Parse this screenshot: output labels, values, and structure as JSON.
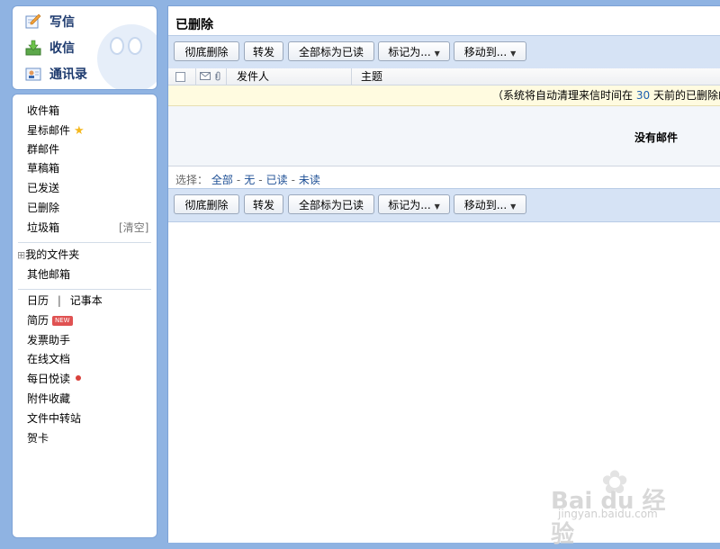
{
  "quick_actions": {
    "compose": "写信",
    "inbox": "收信",
    "contacts": "通讯录"
  },
  "nav": {
    "folders": [
      "收件箱",
      "星标邮件",
      "群邮件",
      "草稿箱",
      "已发送",
      "已删除",
      "垃圾箱"
    ],
    "trash_clear": "[清空]",
    "my_folders": "我的文件夹",
    "my_folders_toggle": "⊞",
    "other_mailboxes": "其他邮箱",
    "calendar": "日历",
    "divider": "|",
    "notebook": "记事本",
    "resume": "简历",
    "new_badge": "NEW",
    "invoice_helper": "发票助手",
    "online_docs": "在线文档",
    "daily_read": "每日悦读",
    "attachments": "附件收藏",
    "file_transfer": "文件中转站",
    "cards": "贺卡"
  },
  "main": {
    "title": "已删除",
    "toolbar": {
      "delete_permanently": "彻底删除",
      "forward": "转发",
      "mark_all_read": "全部标为已读",
      "mark_as": "标记为...",
      "move_to": "移动到..."
    },
    "columns": {
      "sender": "发件人",
      "subject": "主题"
    },
    "notice": {
      "prefix": "（系统将自动清理来信时间在",
      "days": "30",
      "suffix": "天前的已删除邮件）"
    },
    "empty_text": "没有邮件",
    "select": {
      "label": "选择：",
      "all": "全部",
      "none": "无",
      "read": "已读",
      "unread": "未读",
      "separator": "-"
    }
  },
  "watermark": {
    "brand": "Bai du 经验",
    "site": "jingyan.baidu.com"
  },
  "colors": {
    "background": "#8fb3e2",
    "toolbar": "#d6e3f5",
    "notice": "#fffbe0",
    "link": "#1d4f95"
  }
}
